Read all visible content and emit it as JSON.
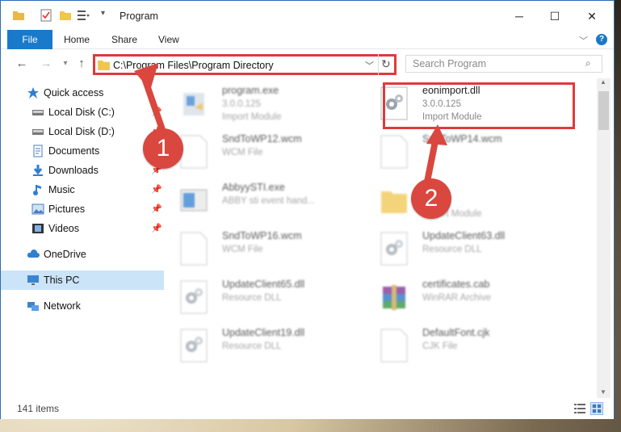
{
  "window": {
    "title": "Program",
    "controls": {
      "minimize": "─",
      "maximize": "☐",
      "close": "✕"
    }
  },
  "ribbon": {
    "tabs": [
      "File",
      "Home",
      "Share",
      "View"
    ]
  },
  "address": {
    "path": "C:\\Program Files\\Program Directory",
    "search_placeholder": "Search Program"
  },
  "sidebar": [
    {
      "label": "Quick access",
      "icon": "star-icon",
      "pin": false
    },
    {
      "label": "Local Disk (C:)",
      "icon": "drive-icon",
      "pin": true
    },
    {
      "label": "Local Disk (D:)",
      "icon": "drive-icon",
      "pin": true
    },
    {
      "label": "Documents",
      "icon": "documents-icon",
      "pin": true
    },
    {
      "label": "Downloads",
      "icon": "download-icon",
      "pin": true
    },
    {
      "label": "Music",
      "icon": "music-icon",
      "pin": true
    },
    {
      "label": "Pictures",
      "icon": "pictures-icon",
      "pin": true
    },
    {
      "label": "Videos",
      "icon": "videos-icon",
      "pin": true
    },
    {
      "label": "OneDrive",
      "icon": "cloud-icon",
      "pin": false
    },
    {
      "label": "This PC",
      "icon": "pc-icon",
      "pin": false,
      "selected": true
    },
    {
      "label": "Network",
      "icon": "network-icon",
      "pin": false
    }
  ],
  "files": [
    {
      "name": "program.exe",
      "line2": "3.0.0.125",
      "line3": "Import Module",
      "icon": "installer-icon"
    },
    {
      "name": "eonimport.dll",
      "line2": "3.0.0.125",
      "line3": "Import Module",
      "icon": "dll-gear-icon",
      "highlighted": true
    },
    {
      "name": "SndToWP12.wcm",
      "line2": "WCM File",
      "line3": "",
      "icon": "blank-file-icon"
    },
    {
      "name": "SndToWP14.wcm",
      "line2": "",
      "line3": "",
      "icon": "blank-file-icon"
    },
    {
      "name": "AbbyySTI.exe",
      "line2": "ABBY sti event hand...",
      "line3": "",
      "icon": "app-icon"
    },
    {
      "name": "",
      "line2": "125",
      "line3": "Import Module",
      "icon": "folder-file-icon"
    },
    {
      "name": "SndToWP16.wcm",
      "line2": "WCM File",
      "line3": "",
      "icon": "blank-file-icon"
    },
    {
      "name": "UpdateClient63.dll",
      "line2": "Resource DLL",
      "line3": "",
      "icon": "dll-gear-icon"
    },
    {
      "name": "UpdateClient65.dll",
      "line2": "Resource DLL",
      "line3": "",
      "icon": "dll-gear-icon"
    },
    {
      "name": "certificates.cab",
      "line2": "WinRAR Archive",
      "line3": "",
      "icon": "archive-icon"
    },
    {
      "name": "UpdateClient19.dll",
      "line2": "Resource DLL",
      "line3": "",
      "icon": "dll-gear-icon"
    },
    {
      "name": "DefaultFont.cjk",
      "line2": "CJK File",
      "line3": "",
      "icon": "blank-file-icon"
    }
  ],
  "status": {
    "item_count": "141 items"
  },
  "annotations": {
    "badge1": "1",
    "badge2": "2"
  },
  "colors": {
    "accent": "#1979ca",
    "annotation": "#d9473f"
  }
}
